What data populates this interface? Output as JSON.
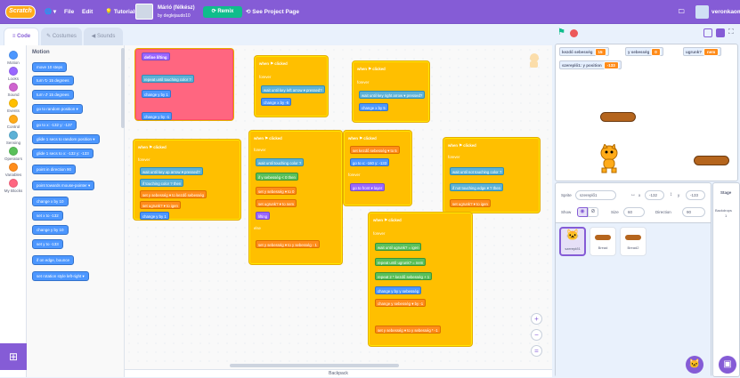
{
  "menu": {
    "logo": "Scratch",
    "file": "File",
    "edit": "Edit",
    "tutorials": "Tutorials",
    "project_title": "Márió (félkész)",
    "author": "by deglejaudo10",
    "remix": "Remix",
    "see_project": "See Project Page",
    "username": "veronkaoma"
  },
  "tabs": {
    "code": "Code",
    "costumes": "Costumes",
    "sounds": "Sounds"
  },
  "categories": [
    "Motion",
    "Looks",
    "Sound",
    "Events",
    "Control",
    "Sensing",
    "Operators",
    "Variables",
    "My Blocks"
  ],
  "category_colors": [
    "#4c97ff",
    "#9966ff",
    "#cf63cf",
    "#ffbf00",
    "#ffab19",
    "#5cb1d6",
    "#59c059",
    "#ff8c1a",
    "#ff6680"
  ],
  "palette": {
    "heading": "Motion",
    "blocks": [
      "move 10 steps",
      "turn ↻ 15 degrees",
      "turn ↺ 15 degrees",
      "go to random position ▾",
      "go to x: -132 y: -137",
      "glide 1 secs to random position ▾",
      "glide 1 secs to x: -132 y: -133",
      "point in direction 90",
      "point towards mouse-pointer ▾",
      "change x by 10",
      "set x to -132",
      "change y by 10",
      "set y to -133",
      "if on edge, bounce",
      "set rotation style left-right ▾"
    ]
  },
  "scripts": {
    "s1": [
      "define lifting",
      "repeat until touching color ?",
      "change y by 1",
      "change y by -1"
    ],
    "s2": [
      "when ⚑ clicked",
      "forever",
      "wait until key left arrow ▾ pressed?",
      "change x by -5"
    ],
    "s3": [
      "when ⚑ clicked",
      "forever",
      "wait until key right arrow ▾ pressed?",
      "change x by 5"
    ],
    "s4": [
      "when ⚑ clicked",
      "forever",
      "wait until key up arrow ▾ pressed?",
      "if touching color ? then",
      "set y sebesség ▾ to kezdő sebesség",
      "set ugrunk? ▾ to igen",
      "change y by 1"
    ],
    "s5": [
      "when ⚑ clicked",
      "forever",
      "wait until touching color ?",
      "if y sebesség < 0 then",
      "set y sebesség ▾ to 0",
      "set ugrunk? ▾ to nem",
      "lifting",
      "else",
      "set y sebesség ▾ to y sebesség - 1"
    ],
    "s6": [
      "when ⚑ clicked",
      "set kezdő sebesség ▾ to 5",
      "go to x: -160 y: -133",
      "forever",
      "go to front ▾ layer"
    ],
    "s7": [
      "when ⚑ clicked",
      "forever",
      "wait until not touching color ?",
      "if not touching edge ▾ ? then",
      "set ugrunk? ▾ to igen"
    ],
    "s8": [
      "when ⚑ clicked",
      "forever",
      "wait until ugrunk? = igen",
      "repeat until ugrunk? = nem",
      "repeat 2 * kezdő sebesség + 1",
      "change y by y sebesség",
      "change y sebesség ▾ by -1",
      "set y sebesség ▾ to y sebesség * -1"
    ]
  },
  "zoom": {
    "in": "+",
    "out": "−",
    "reset": "="
  },
  "backpack": "Backpack",
  "stage": {
    "monitors": [
      {
        "label": "kezdő sebesség",
        "value": "15"
      },
      {
        "label": "y sebesség",
        "value": "0"
      },
      {
        "label": "ugrunk?",
        "value": "nem"
      },
      {
        "label": "szereplő1: y position",
        "value": "-133"
      }
    ]
  },
  "sprite_info": {
    "sprite_label": "Sprite",
    "sprite_name": "szereplő1",
    "x_label": "x",
    "x": "-132",
    "y_label": "y",
    "y": "-133",
    "show_label": "Show",
    "size_label": "Size",
    "size": "60",
    "direction_label": "Direction",
    "direction": "90"
  },
  "sprites": [
    "szereplő1",
    "Bread",
    "Bread2"
  ],
  "stage_pane": {
    "title": "Stage",
    "backdrops_label": "Backdrops",
    "backdrops_count": "1"
  }
}
